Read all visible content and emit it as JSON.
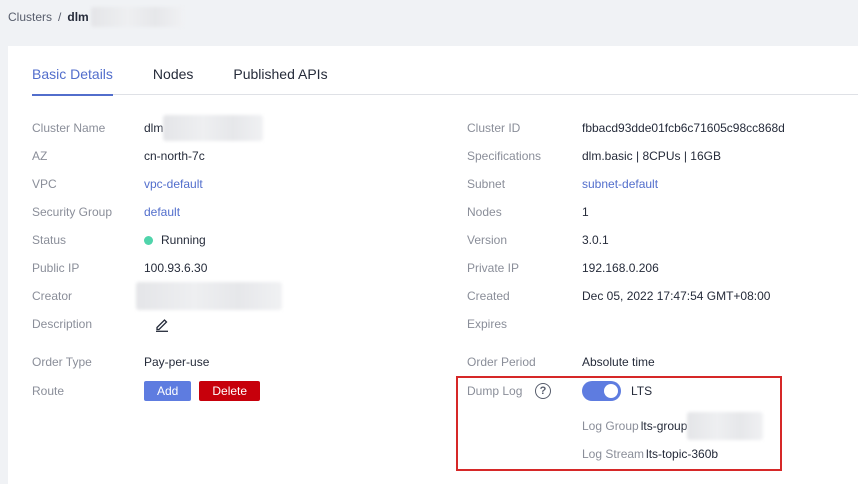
{
  "breadcrumb": {
    "root": "Clusters",
    "separator": "/",
    "current": "dlm"
  },
  "tabs": [
    "Basic Details",
    "Nodes",
    "Published APIs"
  ],
  "left": {
    "cluster_name": {
      "label": "Cluster Name",
      "value": "dlm"
    },
    "az": {
      "label": "AZ",
      "value": "cn-north-7c"
    },
    "vpc": {
      "label": "VPC",
      "value": "vpc-default"
    },
    "security_group": {
      "label": "Security Group",
      "value": "default"
    },
    "status": {
      "label": "Status",
      "value": "Running"
    },
    "public_ip": {
      "label": "Public IP",
      "value": "100.93.6.30"
    },
    "creator": {
      "label": "Creator"
    },
    "description": {
      "label": "Description"
    },
    "order_type": {
      "label": "Order Type",
      "value": "Pay-per-use"
    },
    "route": {
      "label": "Route",
      "add": "Add",
      "delete": "Delete"
    }
  },
  "right": {
    "cluster_id": {
      "label": "Cluster ID",
      "value": "fbbacd93dde01fcb6c71605c98cc868d"
    },
    "specifications": {
      "label": "Specifications",
      "value": "dlm.basic | 8CPUs | 16GB"
    },
    "subnet": {
      "label": "Subnet",
      "value": "subnet-default"
    },
    "nodes": {
      "label": "Nodes",
      "value": "1"
    },
    "version": {
      "label": "Version",
      "value": "3.0.1"
    },
    "private_ip": {
      "label": "Private IP",
      "value": "192.168.0.206"
    },
    "created": {
      "label": "Created",
      "value": "Dec 05, 2022 17:47:54 GMT+08:00"
    },
    "expires": {
      "label": "Expires"
    },
    "order_period": {
      "label": "Order Period",
      "value": "Absolute time"
    },
    "dump_log": {
      "label": "Dump Log",
      "help": "?",
      "toggle_text": "LTS",
      "log_group_label": "Log Group",
      "log_group_value": "lts-group",
      "log_stream_label": "Log Stream",
      "log_stream_value": "lts-topic-360b"
    }
  },
  "colors": {
    "accent": "#526ecc",
    "running": "#50d4ab",
    "danger": "#c7000b",
    "highlight": "#d62828"
  }
}
